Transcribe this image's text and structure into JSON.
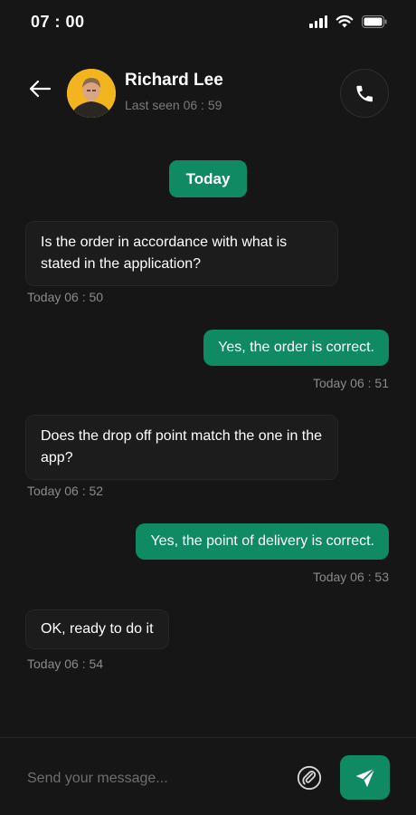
{
  "status_bar": {
    "time": "07 : 00",
    "signal_icon": "cellular-signal-icon",
    "wifi_icon": "wifi-icon",
    "battery_icon": "battery-icon"
  },
  "header": {
    "back_icon": "arrow-left-icon",
    "name": "Richard Lee",
    "last_seen": "Last seen 06 : 59",
    "call_icon": "phone-icon"
  },
  "date_separator": "Today",
  "messages": [
    {
      "direction": "in",
      "text": "Is the order in accordance with what is stated in the application?",
      "time": "Today 06 : 50"
    },
    {
      "direction": "out",
      "text": "Yes, the order is correct.",
      "time": "Today 06 : 51"
    },
    {
      "direction": "in",
      "text": "Does the drop off point match the one in the app?",
      "time": "Today 06 : 52"
    },
    {
      "direction": "out",
      "text": "Yes, the point of delivery is correct.",
      "time": "Today 06 : 53"
    },
    {
      "direction": "in",
      "text": "OK, ready to do it",
      "time": "Today 06 : 54"
    }
  ],
  "composer": {
    "placeholder": "Send your message...",
    "attach_icon": "attachment-icon",
    "send_icon": "send-icon"
  },
  "colors": {
    "background": "#161616",
    "accent": "#0f8a63",
    "incoming_bubble": "#1c1c1c",
    "muted_text": "#8a8a8a"
  }
}
